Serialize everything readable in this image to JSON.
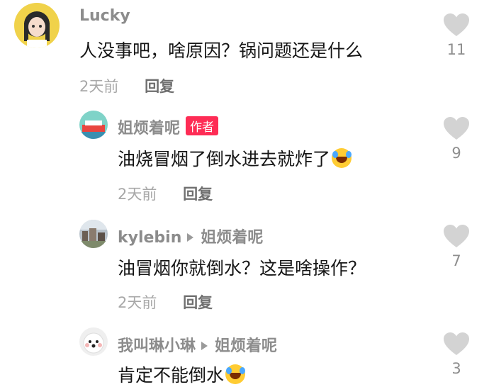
{
  "comments": [
    {
      "user": "Lucky",
      "text": "人没事吧，啥原因？锅问题还是什么",
      "time": "2天前",
      "reply": "回复",
      "likes": "11"
    },
    {
      "user": "姐烦着呢",
      "badge": "作者",
      "text": "油烧冒烟了倒水进去就炸了",
      "emoji": "laughing-crying-emoji",
      "time": "2天前",
      "reply": "回复",
      "likes": "9"
    },
    {
      "user": "kylebin",
      "reply_to": "姐烦着呢",
      "text": "油冒烟你就倒水？这是啥操作？",
      "time": "2天前",
      "reply": "回复",
      "likes": "7"
    },
    {
      "user": "我叫琳小琳",
      "reply_to": "姐烦着呢",
      "text": "肯定不能倒水",
      "emoji": "laughing-crying-emoji",
      "likes": "3"
    }
  ],
  "colors": {
    "heart": "#d3d3d3",
    "badge": "#fe2c55"
  }
}
